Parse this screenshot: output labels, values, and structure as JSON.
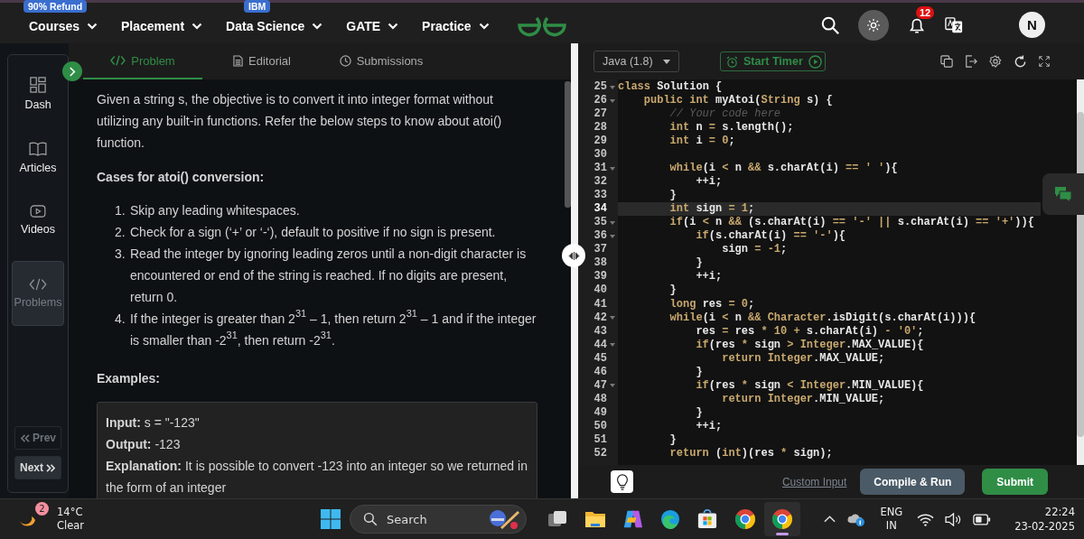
{
  "nav": {
    "items": [
      {
        "label": "Courses",
        "badge": "90% Refund"
      },
      {
        "label": "Placement"
      },
      {
        "label": "Data Science",
        "badge": "IBM"
      },
      {
        "label": "GATE"
      },
      {
        "label": "Practice"
      }
    ],
    "notifications": "12",
    "avatar": "N"
  },
  "sidebar": {
    "items": [
      {
        "label": "Dash",
        "selected": false
      },
      {
        "label": "Articles",
        "selected": false
      },
      {
        "label": "Videos",
        "selected": false
      },
      {
        "label": "Problems",
        "selected": true
      }
    ],
    "prev": {
      "label": "Prev",
      "disabled": true
    },
    "next": {
      "label": "Next",
      "disabled": false
    }
  },
  "problem": {
    "tabs": [
      {
        "label": "Problem",
        "selected": true
      },
      {
        "label": "Editorial",
        "selected": false
      },
      {
        "label": "Submissions",
        "selected": false
      }
    ],
    "intro": "Given a string s, the objective is to convert it into integer format without utilizing any built-in functions. Refer the below steps to know about atoi() function.",
    "cases_heading": "Cases for atoi() conversion:",
    "cases": [
      {
        "num": "1.",
        "text": "Skip any leading whitespaces."
      },
      {
        "num": "2.",
        "text": "Check for a sign (‘+’ or ‘-‘), default to positive if no sign is present."
      },
      {
        "num": "3.",
        "text": "Read the integer by ignoring leading zeros until a non-digit character is encountered or end of the string is reached. If no digits are present, return 0."
      },
      {
        "num": "4.",
        "text": "If the integer is greater than 2$^{31}$ – 1, then return 2$^{31}$ – 1 and if the integer is smaller than -2$^{31}$, then return -2$^{31}$."
      }
    ],
    "examples_heading": "Examples:",
    "example": [
      "**Input:** s = \"-123\"",
      "**Output:** -123",
      "**Explanation:** It is possible to convert -123 into an integer so we returned in the form of an integer"
    ]
  },
  "editor": {
    "language": "Java (1.8)",
    "timer": "Start Timer",
    "lines": [
      {
        "n": "25",
        "fold": true,
        "current": false,
        "segs": [
          {
            "text": "class ",
            "kind": "keyword"
          },
          {
            "text": "Solution {",
            "kind": "plain"
          }
        ]
      },
      {
        "n": "26",
        "fold": true,
        "current": false,
        "segs": [
          {
            "text": "    public int ",
            "kind": "keyword"
          },
          {
            "text": "myAtoi(",
            "kind": "plain"
          },
          {
            "text": "String ",
            "kind": "keyword"
          },
          {
            "text": "s) {",
            "kind": "plain"
          }
        ]
      },
      {
        "n": "27",
        "fold": false,
        "current": false,
        "segs": [
          {
            "text": "        // Your code here",
            "kind": "comment"
          }
        ]
      },
      {
        "n": "28",
        "fold": false,
        "current": false,
        "segs": [
          {
            "text": "        int ",
            "kind": "keyword"
          },
          {
            "text": "n ",
            "kind": "plain"
          },
          {
            "text": "= ",
            "kind": "keyword"
          },
          {
            "text": "s.length();",
            "kind": "plain"
          }
        ]
      },
      {
        "n": "29",
        "fold": false,
        "current": false,
        "segs": [
          {
            "text": "        int ",
            "kind": "keyword"
          },
          {
            "text": "i ",
            "kind": "plain"
          },
          {
            "text": "= 0",
            "kind": "keyword"
          },
          {
            "text": ";",
            "kind": "plain"
          }
        ]
      },
      {
        "n": "30",
        "fold": false,
        "current": false
      },
      {
        "n": "31",
        "fold": true,
        "current": false,
        "segs": [
          {
            "text": "        while",
            "kind": "keyword"
          },
          {
            "text": "(i ",
            "kind": "plain"
          },
          {
            "text": "< ",
            "kind": "keyword"
          },
          {
            "text": "n ",
            "kind": "plain"
          },
          {
            "text": "&& ",
            "kind": "keyword"
          },
          {
            "text": "s.charAt(i) ",
            "kind": "plain"
          },
          {
            "text": "== ' '",
            "kind": "keyword"
          },
          {
            "text": "){",
            "kind": "plain"
          }
        ]
      },
      {
        "n": "32",
        "fold": false,
        "current": false,
        "segs": [
          {
            "text": "            ++i;",
            "kind": "plain"
          }
        ]
      },
      {
        "n": "33",
        "fold": false,
        "current": false,
        "segs": [
          {
            "text": "        }",
            "kind": "plain"
          }
        ]
      },
      {
        "n": "34",
        "fold": false,
        "current": true,
        "segs": [
          {
            "text": "        int ",
            "kind": "keyword"
          },
          {
            "text": "sign ",
            "kind": "plain"
          },
          {
            "text": "= 1",
            "kind": "keyword"
          },
          {
            "text": ";",
            "kind": "plain"
          }
        ]
      },
      {
        "n": "35",
        "fold": true,
        "current": false,
        "segs": [
          {
            "text": "        if",
            "kind": "keyword"
          },
          {
            "text": "(i ",
            "kind": "plain"
          },
          {
            "text": "< ",
            "kind": "keyword"
          },
          {
            "text": "n ",
            "kind": "plain"
          },
          {
            "text": "&& ",
            "kind": "keyword"
          },
          {
            "text": "(s.charAt(i) ",
            "kind": "plain"
          },
          {
            "text": "== '-' || ",
            "kind": "keyword"
          },
          {
            "text": "s.charAt(i) ",
            "kind": "plain"
          },
          {
            "text": "== '+'",
            "kind": "keyword"
          },
          {
            "text": ")){",
            "kind": "plain"
          }
        ]
      },
      {
        "n": "36",
        "fold": true,
        "current": false,
        "segs": [
          {
            "text": "            if",
            "kind": "keyword"
          },
          {
            "text": "(s.charAt(i) ",
            "kind": "plain"
          },
          {
            "text": "== '-'",
            "kind": "keyword"
          },
          {
            "text": "){",
            "kind": "plain"
          }
        ]
      },
      {
        "n": "37",
        "fold": false,
        "current": false,
        "segs": [
          {
            "text": "                sign ",
            "kind": "plain"
          },
          {
            "text": "= -1",
            "kind": "keyword"
          },
          {
            "text": ";",
            "kind": "plain"
          }
        ]
      },
      {
        "n": "38",
        "fold": false,
        "current": false,
        "segs": [
          {
            "text": "            }",
            "kind": "plain"
          }
        ]
      },
      {
        "n": "39",
        "fold": false,
        "current": false,
        "segs": [
          {
            "text": "            ++i;",
            "kind": "plain"
          }
        ]
      },
      {
        "n": "40",
        "fold": false,
        "current": false,
        "segs": [
          {
            "text": "        }",
            "kind": "plain"
          }
        ]
      },
      {
        "n": "41",
        "fold": false,
        "current": false,
        "segs": [
          {
            "text": "        long ",
            "kind": "keyword"
          },
          {
            "text": "res ",
            "kind": "plain"
          },
          {
            "text": "= 0",
            "kind": "keyword"
          },
          {
            "text": ";",
            "kind": "plain"
          }
        ]
      },
      {
        "n": "42",
        "fold": true,
        "current": false,
        "segs": [
          {
            "text": "        while",
            "kind": "keyword"
          },
          {
            "text": "(i ",
            "kind": "plain"
          },
          {
            "text": "< ",
            "kind": "keyword"
          },
          {
            "text": "n ",
            "kind": "plain"
          },
          {
            "text": "&& Character",
            "kind": "keyword"
          },
          {
            "text": ".isDigit(s.charAt(i))){",
            "kind": "plain"
          }
        ]
      },
      {
        "n": "43",
        "fold": false,
        "current": false,
        "segs": [
          {
            "text": "            res ",
            "kind": "plain"
          },
          {
            "text": "= ",
            "kind": "keyword"
          },
          {
            "text": "res ",
            "kind": "plain"
          },
          {
            "text": "* 10 + ",
            "kind": "keyword"
          },
          {
            "text": "s.charAt(i) ",
            "kind": "plain"
          },
          {
            "text": "- '0'",
            "kind": "keyword"
          },
          {
            "text": ";",
            "kind": "plain"
          }
        ]
      },
      {
        "n": "44",
        "fold": true,
        "current": false,
        "segs": [
          {
            "text": "            if",
            "kind": "keyword"
          },
          {
            "text": "(res ",
            "kind": "plain"
          },
          {
            "text": "* ",
            "kind": "keyword"
          },
          {
            "text": "sign ",
            "kind": "plain"
          },
          {
            "text": "> Integer",
            "kind": "keyword"
          },
          {
            "text": ".MAX_VALUE){",
            "kind": "plain"
          }
        ]
      },
      {
        "n": "45",
        "fold": false,
        "current": false,
        "segs": [
          {
            "text": "                return Integer",
            "kind": "keyword"
          },
          {
            "text": ".MAX_VALUE;",
            "kind": "plain"
          }
        ]
      },
      {
        "n": "46",
        "fold": false,
        "current": false,
        "segs": [
          {
            "text": "            }",
            "kind": "plain"
          }
        ]
      },
      {
        "n": "47",
        "fold": true,
        "current": false,
        "segs": [
          {
            "text": "            if",
            "kind": "keyword"
          },
          {
            "text": "(res ",
            "kind": "plain"
          },
          {
            "text": "* ",
            "kind": "keyword"
          },
          {
            "text": "sign ",
            "kind": "plain"
          },
          {
            "text": "< Integer",
            "kind": "keyword"
          },
          {
            "text": ".MIN_VALUE){",
            "kind": "plain"
          }
        ]
      },
      {
        "n": "48",
        "fold": false,
        "current": false,
        "segs": [
          {
            "text": "                return Integer",
            "kind": "keyword"
          },
          {
            "text": ".MIN_VALUE;",
            "kind": "plain"
          }
        ]
      },
      {
        "n": "49",
        "fold": false,
        "current": false,
        "segs": [
          {
            "text": "            }",
            "kind": "plain"
          }
        ]
      },
      {
        "n": "50",
        "fold": false,
        "current": false,
        "segs": [
          {
            "text": "            ++i;",
            "kind": "plain"
          }
        ]
      },
      {
        "n": "51",
        "fold": false,
        "current": false,
        "segs": [
          {
            "text": "        }",
            "kind": "plain"
          }
        ]
      },
      {
        "n": "52",
        "fold": false,
        "current": false,
        "segs": [
          {
            "text": "        return ",
            "kind": "keyword"
          },
          {
            "text": "(",
            "kind": "plain"
          },
          {
            "text": "int",
            "kind": "keyword"
          },
          {
            "text": ")(res ",
            "kind": "plain"
          },
          {
            "text": "* ",
            "kind": "keyword"
          },
          {
            "text": "sign);",
            "kind": "plain"
          }
        ]
      }
    ],
    "custom_input": "Custom Input",
    "run": "Compile & Run",
    "submit": "Submit"
  },
  "taskbar": {
    "weather": {
      "badge": "2",
      "temp": "14°C",
      "condition": "Clear"
    },
    "search": "Search",
    "apps": [
      {
        "kind": "taskview",
        "selected": false
      },
      {
        "kind": "explorer",
        "selected": false
      },
      {
        "kind": "copilot",
        "selected": false
      },
      {
        "kind": "edge",
        "selected": false
      },
      {
        "kind": "store",
        "selected": false
      },
      {
        "kind": "chrome",
        "selected": false
      },
      {
        "kind": "chrome",
        "selected": true
      }
    ],
    "lang": "ENG",
    "region": "IN",
    "time": "22:24",
    "date": "23-02-2025"
  }
}
